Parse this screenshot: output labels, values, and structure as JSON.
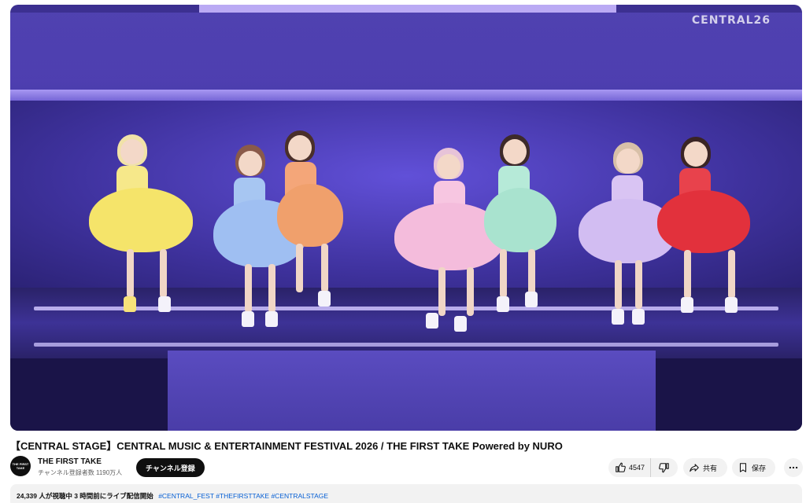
{
  "player": {
    "watermark": "CENTRAL26"
  },
  "video": {
    "title": "【CENTRAL STAGE】CENTRAL MUSIC & ENTERTAINMENT FESTIVAL 2026 / THE FIRST TAKE Powered by NURO"
  },
  "channel": {
    "avatar_text": "THE FIRST TAKE",
    "name": "THE FIRST TAKE",
    "subscribers": "チャンネル登録者数 1190万人",
    "subscribe_label": "チャンネル登録"
  },
  "actions": {
    "like_count": "4547",
    "share_label": "共有",
    "save_label": "保存",
    "icons": [
      "thumbs-up-icon",
      "thumbs-down-icon",
      "share-icon",
      "bookmark-icon",
      "more-icon"
    ]
  },
  "description": {
    "meta": "24,339 人が視聴中  3 時間前にライブ配信開始",
    "tags": "#CENTRAL_FEST #THEFIRSTTAKE #CENTRALSTAGE"
  },
  "colors": {
    "accent_link": "#065fd4",
    "subscribe_bg": "#0f0f0f",
    "pill_bg": "#f2f2f2"
  }
}
